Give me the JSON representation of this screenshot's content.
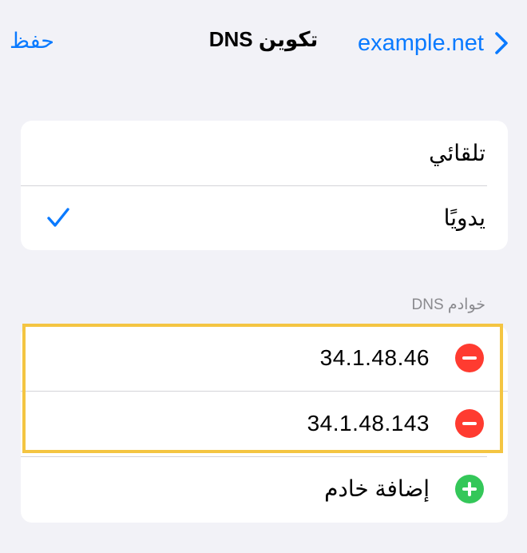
{
  "navbar": {
    "back_label": "example.net",
    "title": "تكوين DNS",
    "save_label": "حفظ"
  },
  "mode": {
    "options": [
      {
        "label": "تلقائي",
        "selected": false
      },
      {
        "label": "يدويًا",
        "selected": true
      }
    ]
  },
  "servers": {
    "header": "خوادم DNS",
    "items": [
      "34.1.48.46",
      "34.1.48.143"
    ],
    "add_label": "إضافة خادم"
  },
  "colors": {
    "accent": "#0a7aff",
    "delete": "#ff3b30",
    "add": "#34c759",
    "highlight": "#f4c542",
    "background": "#f2f2f7"
  }
}
